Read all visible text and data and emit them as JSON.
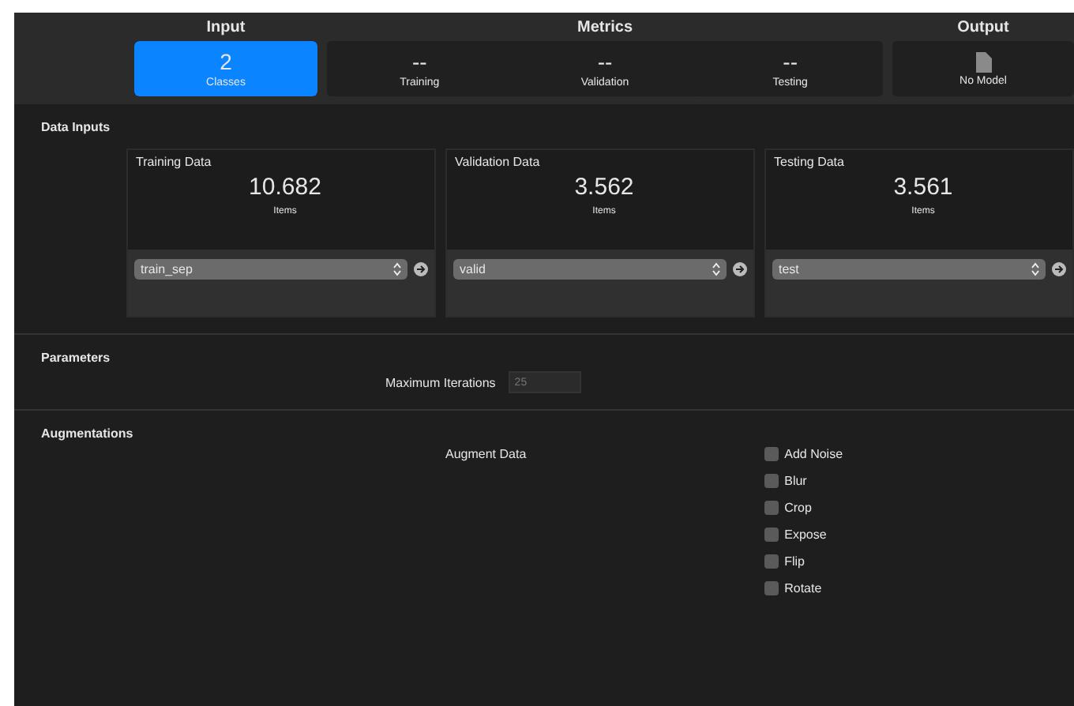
{
  "header": {
    "groups": [
      {
        "title": "Input",
        "tiles": [
          {
            "value": "2",
            "label": "Classes",
            "selected": true,
            "kind": "text"
          }
        ]
      },
      {
        "title": "Metrics",
        "tiles": [
          {
            "value": "--",
            "label": "Training",
            "selected": false,
            "kind": "text"
          },
          {
            "value": "--",
            "label": "Validation",
            "selected": false,
            "kind": "text"
          },
          {
            "value": "--",
            "label": "Testing",
            "selected": false,
            "kind": "text"
          }
        ]
      },
      {
        "title": "Output",
        "tiles": [
          {
            "label": "No Model",
            "selected": false,
            "kind": "document"
          }
        ]
      }
    ]
  },
  "data_inputs": {
    "title": "Data Inputs",
    "cards": [
      {
        "title": "Training Data",
        "count": "10.682",
        "unit": "Items",
        "source": "train_sep"
      },
      {
        "title": "Validation Data",
        "count": "3.562",
        "unit": "Items",
        "source": "valid"
      },
      {
        "title": "Testing Data",
        "count": "3.561",
        "unit": "Items",
        "source": "test"
      }
    ]
  },
  "parameters": {
    "title": "Parameters",
    "label": "Maximum Iterations",
    "placeholder": "25"
  },
  "augmentations": {
    "title": "Augmentations",
    "label": "Augment Data",
    "options": [
      {
        "label": "Add Noise",
        "checked": false
      },
      {
        "label": "Blur",
        "checked": false
      },
      {
        "label": "Crop",
        "checked": false
      },
      {
        "label": "Expose",
        "checked": false
      },
      {
        "label": "Flip",
        "checked": false
      },
      {
        "label": "Rotate",
        "checked": false
      }
    ]
  }
}
